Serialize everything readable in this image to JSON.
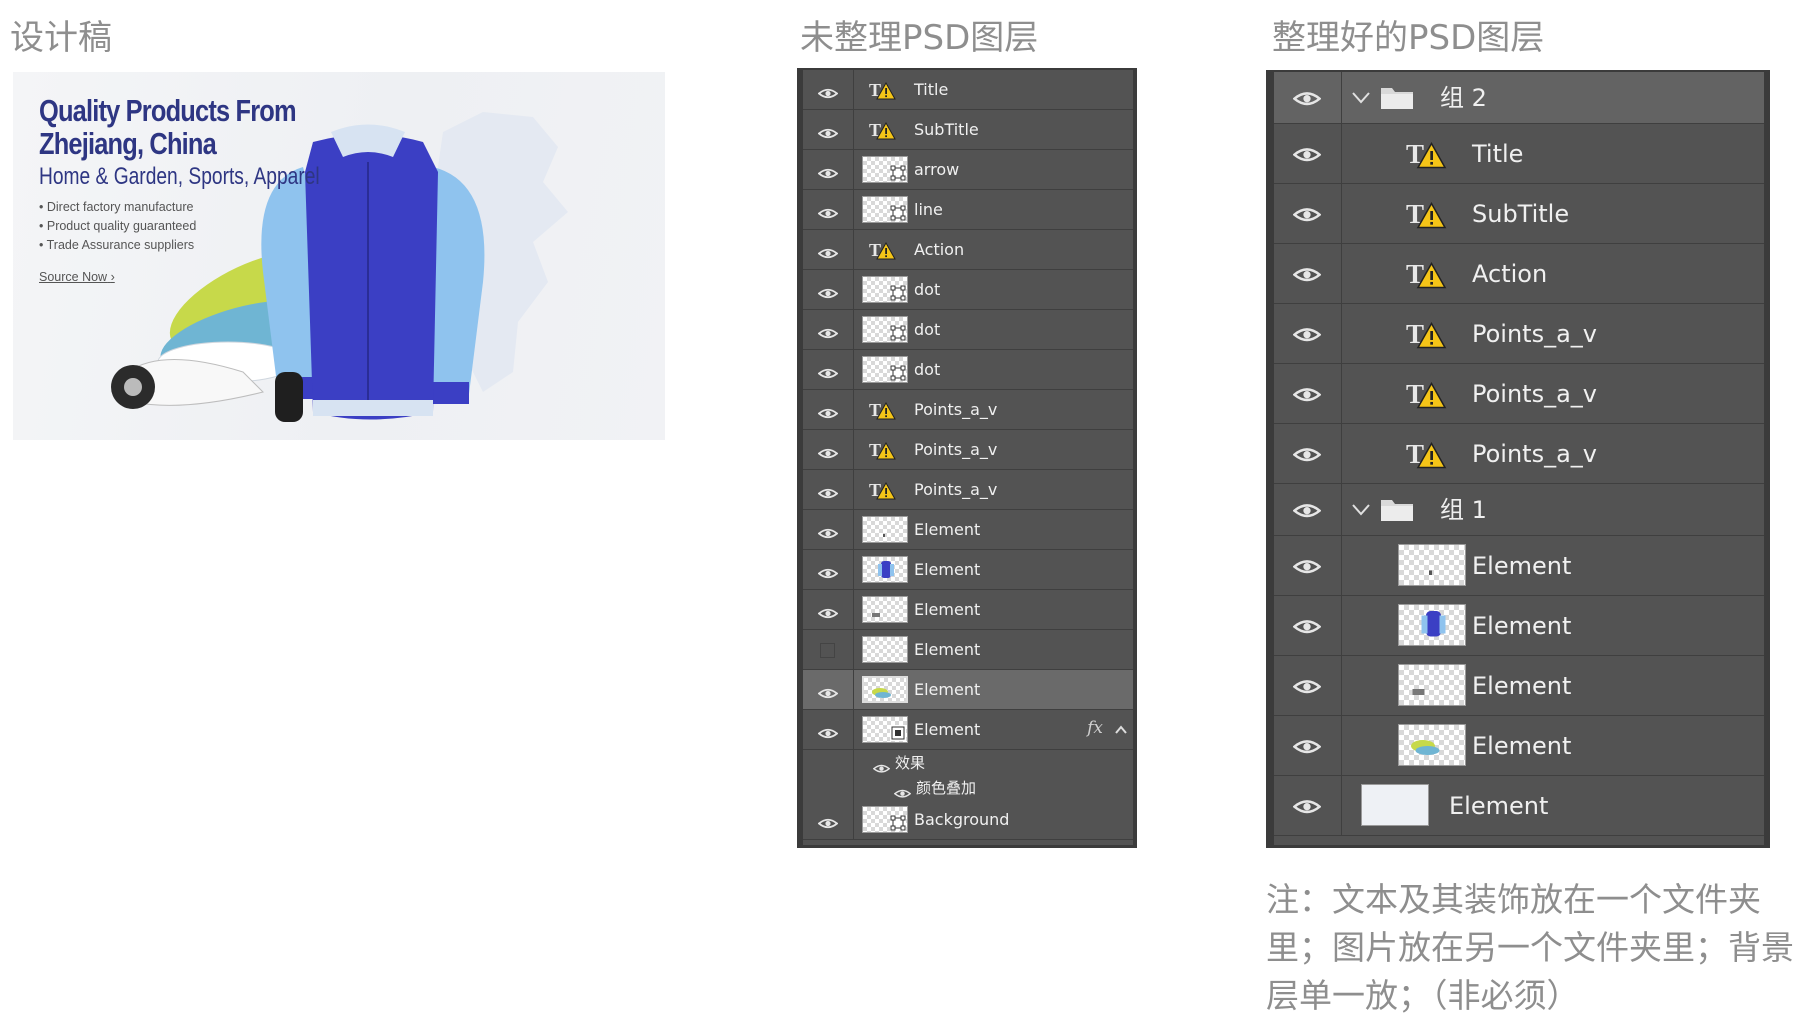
{
  "titles": {
    "design": "设计稿",
    "unorganized": "未整理PSD图层",
    "organized": "整理好的PSD图层"
  },
  "design": {
    "headline": "Quality Products From Zhejiang, China",
    "subheadline": "Home & Garden, Sports, Apparel",
    "bullets": [
      "Direct factory manufacture",
      "Product quality guaranteed",
      "Trade Assurance suppliers"
    ],
    "link": "Source Now",
    "link_suffix": "›",
    "colors": {
      "headline": "#2e3683",
      "jacket": "#3b3fc4",
      "sleeve": "#8fc3ee"
    }
  },
  "panel1": {
    "layers": [
      {
        "kind": "text",
        "label": "Title",
        "visible": true
      },
      {
        "kind": "text",
        "label": "SubTitle",
        "visible": true
      },
      {
        "kind": "shape",
        "label": "arrow",
        "visible": true
      },
      {
        "kind": "shape",
        "label": "line",
        "visible": true
      },
      {
        "kind": "text",
        "label": "Action",
        "visible": true
      },
      {
        "kind": "shape",
        "label": "dot",
        "visible": true
      },
      {
        "kind": "shape",
        "label": "dot",
        "visible": true
      },
      {
        "kind": "shape",
        "label": "dot",
        "visible": true
      },
      {
        "kind": "text",
        "label": "Points_a_v",
        "visible": true
      },
      {
        "kind": "text",
        "label": "Points_a_v",
        "visible": true
      },
      {
        "kind": "text",
        "label": "Points_a_v",
        "visible": true
      },
      {
        "kind": "image",
        "label": "Element",
        "visible": true
      },
      {
        "kind": "image",
        "label": "Element",
        "visible": true
      },
      {
        "kind": "image",
        "label": "Element",
        "visible": true
      },
      {
        "kind": "image",
        "label": "Element",
        "visible": false
      },
      {
        "kind": "image",
        "label": "Element",
        "visible": true,
        "selected": true
      },
      {
        "kind": "smart",
        "label": "Element",
        "visible": true,
        "fx": "fx"
      },
      {
        "kind": "effects",
        "label": "效果"
      },
      {
        "kind": "effect",
        "label": "颜色叠加"
      },
      {
        "kind": "shape",
        "label": "Background",
        "visible": true
      }
    ]
  },
  "panel2": {
    "group2": {
      "label": "组 2",
      "children": [
        "Title",
        "SubTitle",
        "Action",
        "Points_a_v",
        "Points_a_v",
        "Points_a_v"
      ]
    },
    "group1": {
      "label": "组 1",
      "children": [
        "Element",
        "Element",
        "Element",
        "Element"
      ]
    },
    "background": {
      "label": "Element"
    }
  },
  "note": "注：文本及其装饰放在一个文件夹里；图片放在另一个文件夹里；背景层单一放；（非必须）",
  "icons": {
    "visibility": "eye-icon",
    "text_layer": "text-layer-warning-icon",
    "folder": "folder-icon",
    "chevron": "chevron-down-icon"
  }
}
